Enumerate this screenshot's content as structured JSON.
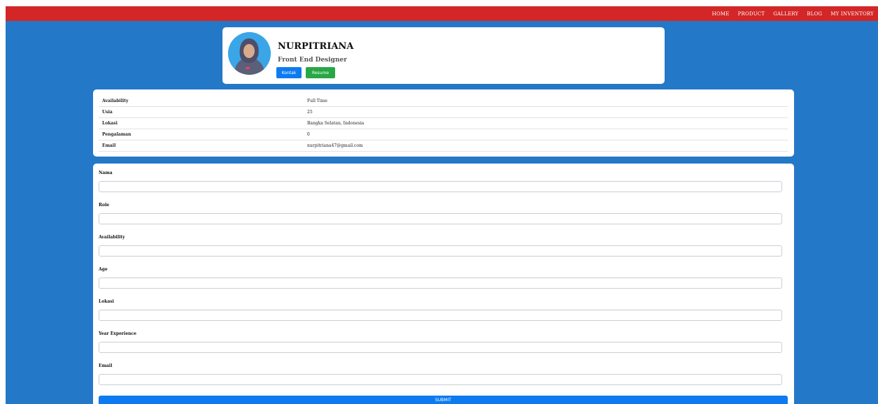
{
  "nav": {
    "links": [
      "HOME",
      "PRODUCT",
      "GALLERY",
      "BLOG",
      "MY INVENTORY"
    ]
  },
  "profile": {
    "name": "NURPITRIANA",
    "role": "Front End Designer",
    "contact_label": "Kontak",
    "resume_label": "Resume"
  },
  "info": {
    "rows": [
      {
        "key": "Availability",
        "value": "Full Time"
      },
      {
        "key": "Usia",
        "value": "25"
      },
      {
        "key": "Lokasi",
        "value": "Bangka Selatan, Indonesia"
      },
      {
        "key": "Pengalaman",
        "value": "0"
      },
      {
        "key": "Email",
        "value": "nurpitriana47@gmail.com"
      }
    ]
  },
  "form": {
    "fields": [
      {
        "label": "Nama",
        "value": ""
      },
      {
        "label": "Role",
        "value": ""
      },
      {
        "label": "Availability",
        "value": ""
      },
      {
        "label": "Age",
        "value": ""
      },
      {
        "label": "Lokasi",
        "value": ""
      },
      {
        "label": "Year Experience",
        "value": ""
      },
      {
        "label": "Email",
        "value": ""
      }
    ],
    "submit_label": "SUBMIT"
  },
  "colors": {
    "navbar": "#d32626",
    "page_background": "#2478c8",
    "primary_button": "#0d7bef",
    "success_button": "#28a745"
  }
}
